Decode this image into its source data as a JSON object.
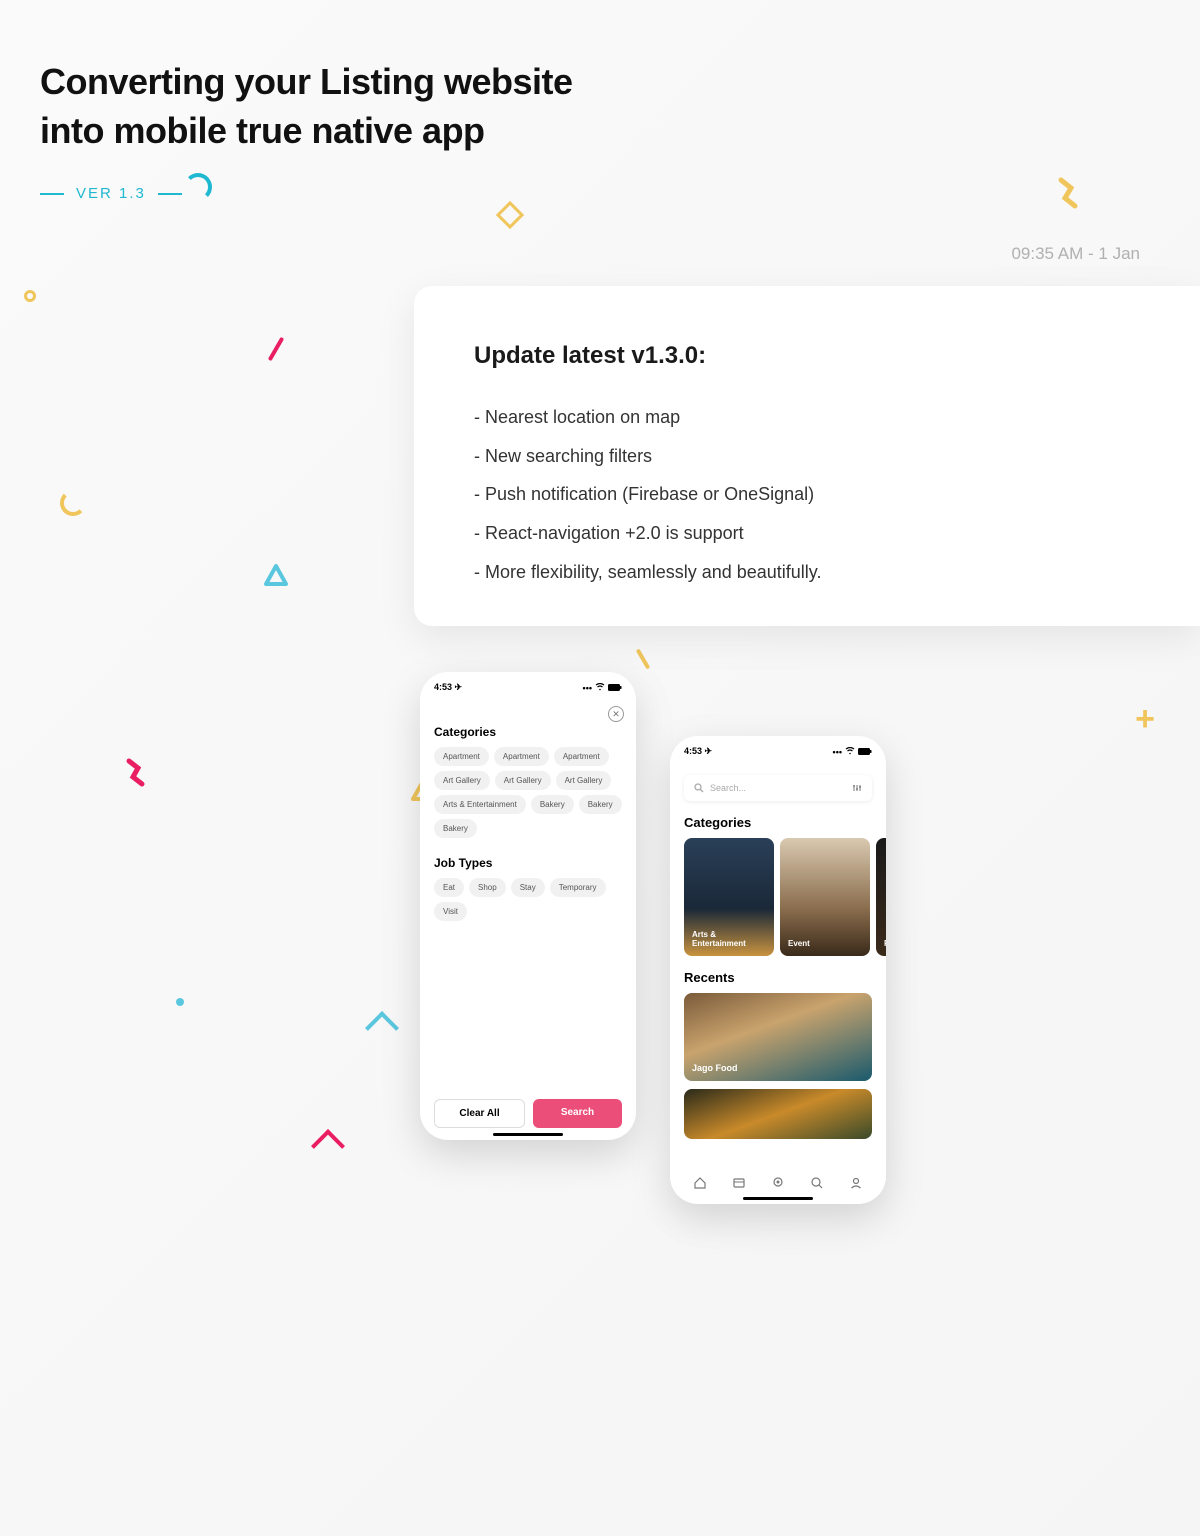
{
  "headline_line1": "Converting your Listing website",
  "headline_line2": "into mobile true native app",
  "version_label": "VER 1.3",
  "timestamp": "09:35 AM - 1 Jan",
  "update_card": {
    "title": "Update latest v1.3.0:",
    "items": [
      "- Nearest location on map",
      "- New searching filters",
      "- Push notification (Firebase or OneSignal)",
      "- React-navigation +2.0 is support",
      "- More flexibility, seamlessly and beautifully."
    ]
  },
  "phone_left": {
    "time": "4:53",
    "close": "✕",
    "categories_h": "Categories",
    "categories": [
      "Apartment",
      "Apartment",
      "Apartment",
      "Art Gallery",
      "Art Gallery",
      "Art Gallery",
      "Arts & Entertainment",
      "Bakery",
      "Bakery",
      "Bakery"
    ],
    "jobtypes_h": "Job Types",
    "jobtypes": [
      "Eat",
      "Shop",
      "Stay",
      "Temporary",
      "Visit"
    ],
    "clear_btn": "Clear All",
    "search_btn": "Search"
  },
  "phone_right": {
    "time": "4:53",
    "search_placeholder": "Search...",
    "categories_h": "Categories",
    "cats": [
      {
        "label": "Arts & Entertainment"
      },
      {
        "label": "Event"
      },
      {
        "label": "Fo"
      }
    ],
    "recents_h": "Recents",
    "recents": [
      {
        "label": "Jago Food"
      },
      {
        "label": ""
      }
    ]
  }
}
